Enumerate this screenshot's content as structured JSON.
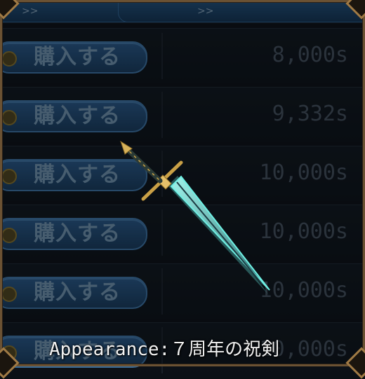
{
  "tabs": [
    {
      "label": ">>"
    },
    {
      "label": ">>"
    }
  ],
  "rows": [
    {
      "button_label": "購入する",
      "price": "8,000s"
    },
    {
      "button_label": "購入する",
      "price": "9,332s"
    },
    {
      "button_label": "購入する",
      "price": "10,000s"
    },
    {
      "button_label": "購入する",
      "price": "10,000s"
    },
    {
      "button_label": "購入する",
      "price": "10,000s"
    },
    {
      "button_label": "購入する",
      "price": "10,000s"
    }
  ],
  "caption": "Appearance:７周年の祝剣",
  "colors": {
    "accent": "#26527f",
    "blade_glow": "#5fe0d6",
    "hilt": "#c9a046"
  }
}
